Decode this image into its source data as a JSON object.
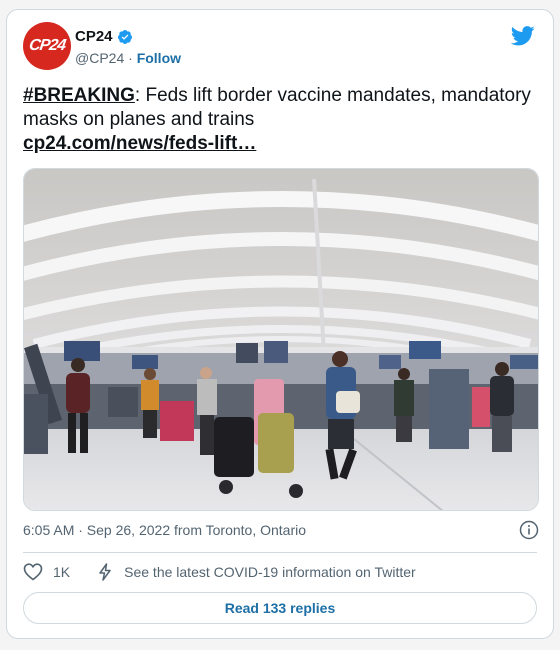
{
  "author": {
    "avatar_text": "CP24",
    "name": "CP24",
    "handle": "@CP24",
    "separator": " · ",
    "follow_label": "Follow"
  },
  "tweet": {
    "hashtag": "#BREAKING",
    "body": ": Feds lift border vaccine mandates, mandatory masks on planes and trains",
    "link": "cp24.com/news/feds-lift…"
  },
  "meta": {
    "timestamp": "6:05 AM · Sep 26, 2022 from Toronto, Ontario"
  },
  "actions": {
    "like_count": "1K",
    "covid_info": "See the latest COVID-19 information on Twitter"
  },
  "replies_button": "Read 133 replies",
  "colors": {
    "brand_red": "#d6281f",
    "twitter_blue": "#1d9bf0",
    "link_blue": "#1d6fa5"
  },
  "icons": [
    "verified-badge-icon",
    "twitter-bird-icon",
    "info-icon",
    "heart-icon",
    "lightning-icon"
  ]
}
